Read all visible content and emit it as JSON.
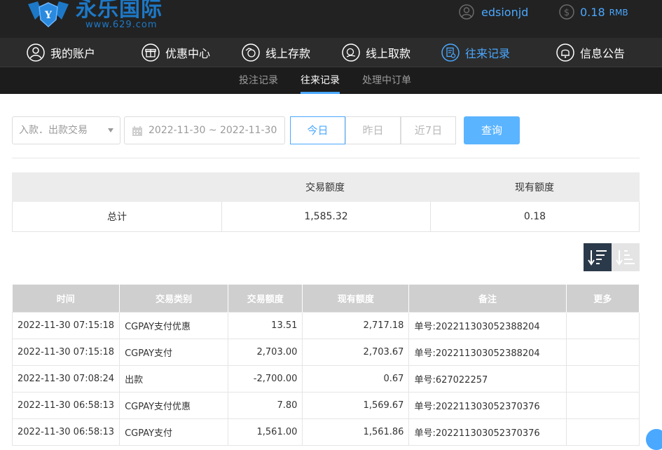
{
  "brand": {
    "name": "永乐国际",
    "domain": "www.629.com"
  },
  "user": {
    "username": "edsionjd",
    "balance": "0.18",
    "currency": "RMB"
  },
  "nav": [
    {
      "label": "我的账户",
      "icon": "user-icon"
    },
    {
      "label": "优惠中心",
      "icon": "gift-icon"
    },
    {
      "label": "线上存款",
      "icon": "deposit-icon"
    },
    {
      "label": "线上取款",
      "icon": "withdraw-icon"
    },
    {
      "label": "往来记录",
      "icon": "records-icon",
      "active": true
    },
    {
      "label": "信息公告",
      "icon": "bell-icon"
    }
  ],
  "subnav": [
    {
      "label": "投注记录"
    },
    {
      "label": "往来记录",
      "active": true
    },
    {
      "label": "处理中订单"
    }
  ],
  "filter": {
    "type_value": "入款．出款交易",
    "date_range": "2022-11-30 ~ 2022-11-30",
    "quick": [
      "今日",
      "昨日",
      "近7日"
    ],
    "quick_active": "今日",
    "query_label": "查询"
  },
  "summary": {
    "headers": [
      "",
      "交易额度",
      "现有额度"
    ],
    "row_label": "总计",
    "amount": "1,585.32",
    "balance": "0.18"
  },
  "colors": {
    "accent": "#4aa8ff",
    "header_bg": "#222222",
    "nav_bg": "#2c2c2c"
  },
  "table": {
    "headers": [
      "时间",
      "交易类别",
      "交易额度",
      "现有额度",
      "备注",
      "更多"
    ],
    "rows": [
      {
        "time": "2022-11-30 07:15:18",
        "type": "CGPAY支付优惠",
        "amount": "13.51",
        "balance": "2,717.18",
        "note": "单号:202211303052388204",
        "more": ""
      },
      {
        "time": "2022-11-30 07:15:18",
        "type": "CGPAY支付",
        "amount": "2,703.00",
        "balance": "2,703.67",
        "note": "单号:202211303052388204",
        "more": ""
      },
      {
        "time": "2022-11-30 07:08:24",
        "type": "出款",
        "amount": "-2,700.00",
        "balance": "0.67",
        "note": "单号:627022257",
        "more": ""
      },
      {
        "time": "2022-11-30 06:58:13",
        "type": "CGPAY支付优惠",
        "amount": "7.80",
        "balance": "1,569.67",
        "note": "单号:202211303052370376",
        "more": ""
      },
      {
        "time": "2022-11-30 06:58:13",
        "type": "CGPAY支付",
        "amount": "1,561.00",
        "balance": "1,561.86",
        "note": "单号:202211303052370376",
        "more": ""
      }
    ]
  }
}
